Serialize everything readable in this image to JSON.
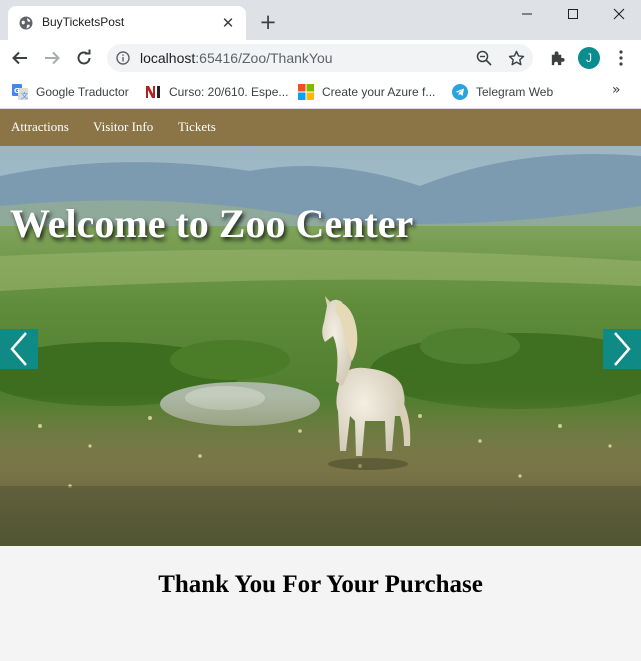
{
  "browser": {
    "tab": {
      "title": "BuyTicketsPost",
      "close_glyph": "✕",
      "favicon": "globe-icon"
    },
    "new_tab_glyph": "+",
    "url": {
      "host": "localhost",
      "rest": ":65416/Zoo/ThankYou"
    },
    "avatar_letter": "J",
    "avatar_color": "#0a8d8f",
    "bookmarks": [
      {
        "label": "Google Traductor",
        "icon": "google-translate-icon"
      },
      {
        "label": "Curso: 20/610. Espe...",
        "icon": "ni-icon"
      },
      {
        "label": "Create your Azure f...",
        "icon": "microsoft-icon"
      },
      {
        "label": "Telegram Web",
        "icon": "telegram-icon"
      }
    ],
    "bookmarks_more": "»"
  },
  "site": {
    "nav": [
      {
        "label": "Attractions"
      },
      {
        "label": "Visitor Info"
      },
      {
        "label": "Tickets"
      }
    ],
    "nav_color": "#8b7547",
    "hero": {
      "title": "Welcome to Zoo Center",
      "arrow_color": "#0f8a85"
    },
    "message": "Thank You For Your Purchase"
  }
}
